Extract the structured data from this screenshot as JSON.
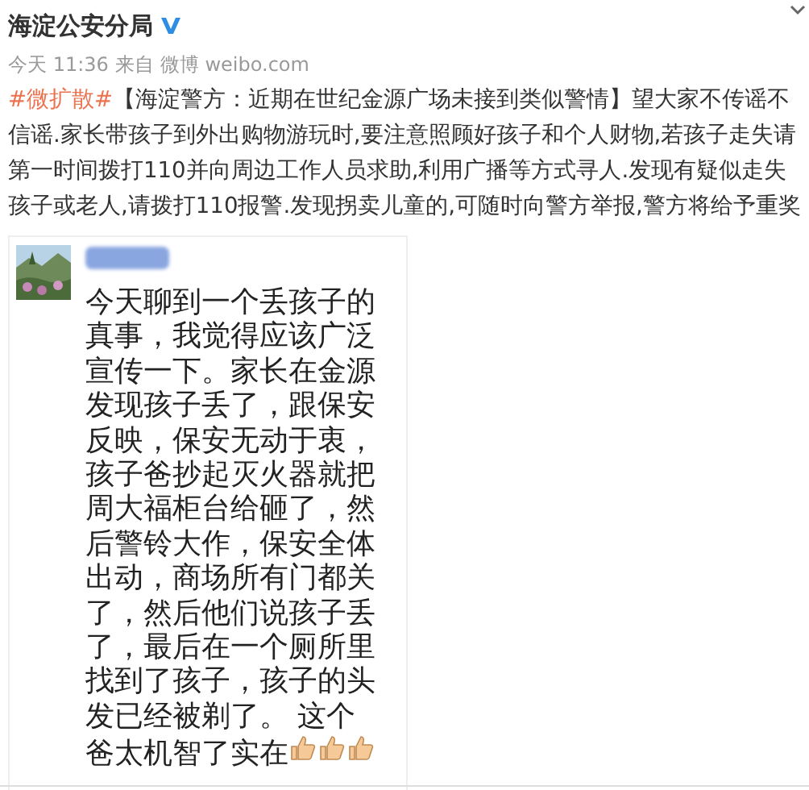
{
  "post": {
    "author": "海淀公安分局",
    "verified": true,
    "time": "今天 11:36",
    "source_prefix": "来自",
    "source": "微博 weibo.com",
    "hashtag": "#微扩散#",
    "text": "【海淀警方：近期在世纪金源广场未接到类似警情】望大家不传谣不信谣.家长带孩子到外出购物游玩时,要注意照顾好孩子和个人财物,若孩子走失请第一时间拨打110并向周边工作人员求助,利用广播等方式寻人.发现有疑似走失孩子或老人,请拨打110报警.发现拐卖儿童的,可随时向警方举报,警方将给予重奖"
  },
  "image": {
    "text": "今天聊到一个丢孩子的真事，我觉得应该广泛宣传一下。家长在金源发现孩子丢了，跟保安反映，保安无动于衷，孩子爸抄起灭火器就把周大福柜台给砸了，然后警铃大作，保安全体出动，商场所有门都关了，然后他们说孩子丢了，最后在一个厕所里找到了孩子，孩子的头发已经被剃了。 这个爸太机智了实在"
  }
}
